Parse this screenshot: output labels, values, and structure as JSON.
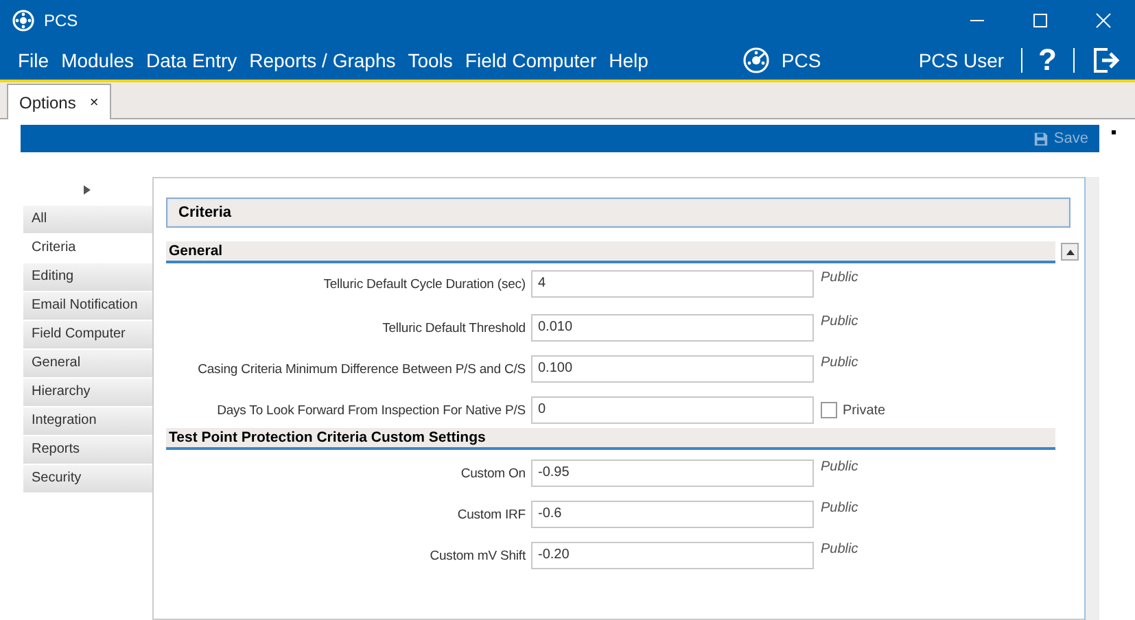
{
  "window": {
    "title": "PCS"
  },
  "menu": [
    "File",
    "Modules",
    "Data Entry",
    "Reports / Graphs",
    "Tools",
    "Field Computer",
    "Help"
  ],
  "brand": "PCS",
  "user": "PCS User",
  "help": "?",
  "tabs": [
    {
      "label": "Options",
      "selected": true,
      "close": "×"
    }
  ],
  "toolbar": {
    "save": "Save",
    "save_disabled": true
  },
  "sidebar": {
    "items": [
      {
        "label": "All",
        "selected": false
      },
      {
        "label": "Criteria",
        "selected": true
      },
      {
        "label": "Editing",
        "selected": false
      },
      {
        "label": "Email Notification",
        "selected": false
      },
      {
        "label": "Field Computer",
        "selected": false
      },
      {
        "label": "General",
        "selected": false
      },
      {
        "label": "Hierarchy",
        "selected": false
      },
      {
        "label": "Integration",
        "selected": false
      },
      {
        "label": "Reports",
        "selected": false
      },
      {
        "label": "Security",
        "selected": false
      }
    ]
  },
  "panel_title": "Criteria",
  "sections": [
    {
      "title": "General",
      "rows": [
        {
          "label": "Telluric Default Cycle Duration (sec)",
          "value": "4",
          "visibility": {
            "kind": "text",
            "label": "Public"
          }
        },
        {
          "label": "Telluric Default Threshold",
          "value": "0.010",
          "visibility": {
            "kind": "text",
            "label": "Public"
          }
        },
        {
          "label": "Casing Criteria Minimum Difference Between P/S and C/S",
          "value": "0.100",
          "visibility": {
            "kind": "text",
            "label": "Public"
          }
        },
        {
          "label": "Days To Look Forward From Inspection For Native P/S",
          "value": "0",
          "visibility": {
            "kind": "checkbox",
            "label": "Private",
            "checked": false
          }
        }
      ]
    },
    {
      "title": "Test Point Protection Criteria Custom Settings",
      "rows": [
        {
          "label": "Custom On",
          "value": "-0.95",
          "visibility": {
            "kind": "text",
            "label": "Public"
          }
        },
        {
          "label": "Custom IRF",
          "value": "-0.6",
          "visibility": {
            "kind": "text",
            "label": "Public"
          }
        },
        {
          "label": "Custom mV Shift",
          "value": "-0.20",
          "visibility": {
            "kind": "text",
            "label": "Public"
          }
        }
      ]
    }
  ]
}
